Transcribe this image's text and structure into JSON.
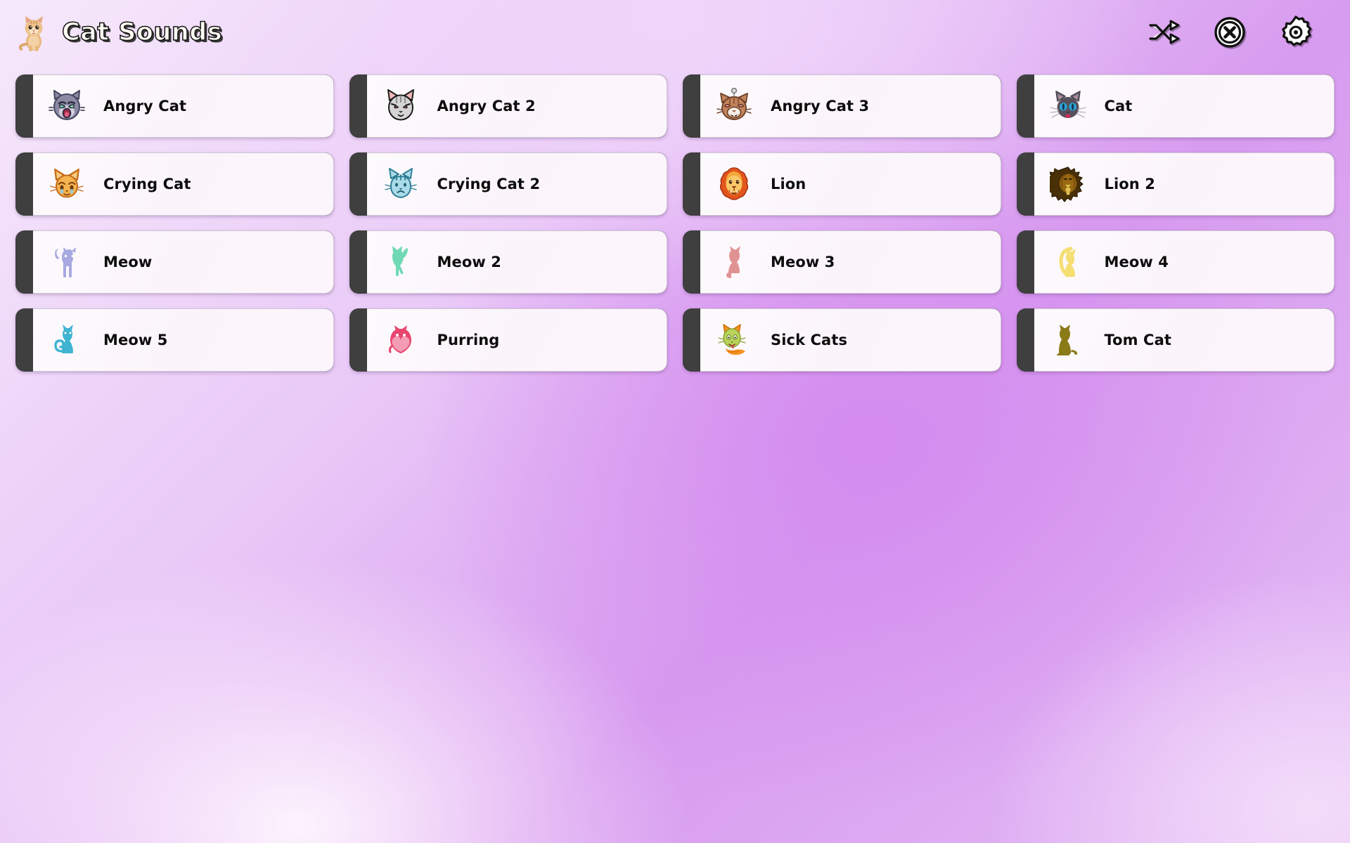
{
  "header": {
    "title": "Cat Sounds",
    "logo_icon": "kitten-photo-icon",
    "actions": [
      {
        "name": "shuffle-button",
        "icon": "shuffle-icon",
        "label": "Shuffle"
      },
      {
        "name": "stop-button",
        "icon": "stop-circle-x-icon",
        "label": "Stop"
      },
      {
        "name": "settings-button",
        "icon": "gear-icon",
        "label": "Settings"
      }
    ]
  },
  "colors": {
    "background_top_left": "#f6e9fb",
    "background_center": "#d79bef",
    "background_bottom_left": "#fdf3fd",
    "background_bottom_right": "#edd5f7",
    "card_accent_bar": "#3f3f3f",
    "card_face": "#fcf6fc",
    "card_border": "#cfc6d4",
    "label_text": "#0d0d0d",
    "title_text": "#fffdf4",
    "title_outline": "#141414"
  },
  "grid": {
    "columns": 4,
    "rows": 4,
    "items": [
      {
        "label": "Angry Cat",
        "icon": "angry-cat-face-icon"
      },
      {
        "label": "Angry Cat 2",
        "icon": "angry-cat-2-face-icon"
      },
      {
        "label": "Angry Cat 3",
        "icon": "angry-cat-3-face-icon"
      },
      {
        "label": "Cat",
        "icon": "cat-face-icon"
      },
      {
        "label": "Crying Cat",
        "icon": "crying-cat-face-icon"
      },
      {
        "label": "Crying Cat 2",
        "icon": "crying-cat-2-face-icon"
      },
      {
        "label": "Lion",
        "icon": "lion-face-icon"
      },
      {
        "label": "Lion 2",
        "icon": "lion-2-face-icon"
      },
      {
        "label": "Meow",
        "icon": "standing-cat-silhouette-icon"
      },
      {
        "label": "Meow 2",
        "icon": "stretching-cat-silhouette-icon"
      },
      {
        "label": "Meow 3",
        "icon": "sitting-cat-silhouette-icon"
      },
      {
        "label": "Meow 4",
        "icon": "arched-cat-silhouette-icon"
      },
      {
        "label": "Meow 5",
        "icon": "curled-tail-cat-silhouette-icon"
      },
      {
        "label": "Purring",
        "icon": "purring-cat-heart-icon"
      },
      {
        "label": "Sick Cats",
        "icon": "sick-cat-icon"
      },
      {
        "label": "Tom Cat",
        "icon": "tom-cat-silhouette-icon"
      }
    ]
  }
}
